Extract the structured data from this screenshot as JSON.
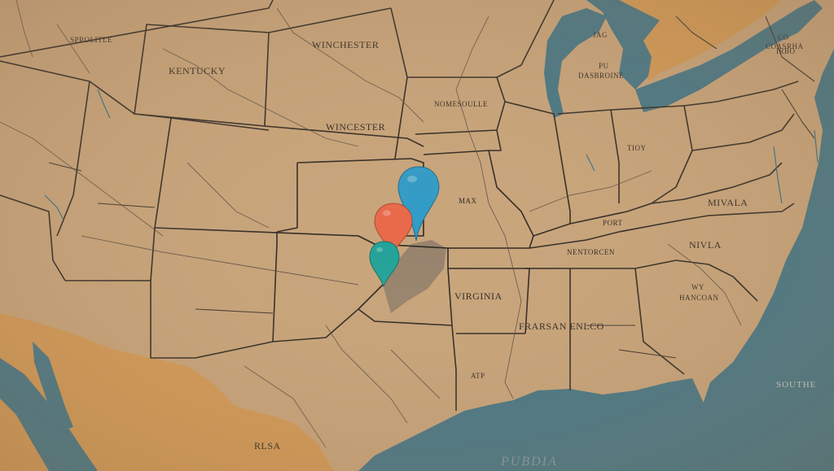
{
  "map": {
    "labels": {
      "kentucky": "KENTUCKY",
      "winchester_top": "WINCHESTER",
      "wincester": "WINCESTER",
      "nomesoulle": "NOMESOULLE",
      "max": "MAX",
      "virginia": "VIRGINIA",
      "frarsan": "FRARSAN ENLCO",
      "nentorcen": "NENTORCEN",
      "port": "PORT",
      "nivla": "NIVLA",
      "mivala": "MIVALA",
      "hancoan": "HANCOAN",
      "wy": "WY",
      "pu": "PU",
      "dasbroine": "DASBROINE",
      "jag": "JAG",
      "rlsa": "RLSA",
      "pubdia": "PUBDIA",
      "southe": "SOUTHE",
      "co": "CO",
      "coasrha": "COASRHA",
      "irbo": "IRBO",
      "tioy": "TIOY",
      "atp": "ATP",
      "sprolitle": "SPROLITLE"
    },
    "colors": {
      "land": "#c9a57c",
      "land_shade": "#b89873",
      "water": "#3f7588",
      "foreign_land": "#d49a55",
      "highlight": "#8e7d6b",
      "pin_blue": "#2e9cc9",
      "pin_orange": "#e9694a",
      "pin_teal": "#21a39a"
    },
    "pins": [
      {
        "id": "blue",
        "color": "#2e9cc9",
        "icon": "map-pin-icon"
      },
      {
        "id": "orange",
        "color": "#e9694a",
        "icon": "map-pin-icon"
      },
      {
        "id": "teal",
        "color": "#21a39a",
        "icon": "map-pin-icon"
      }
    ]
  }
}
